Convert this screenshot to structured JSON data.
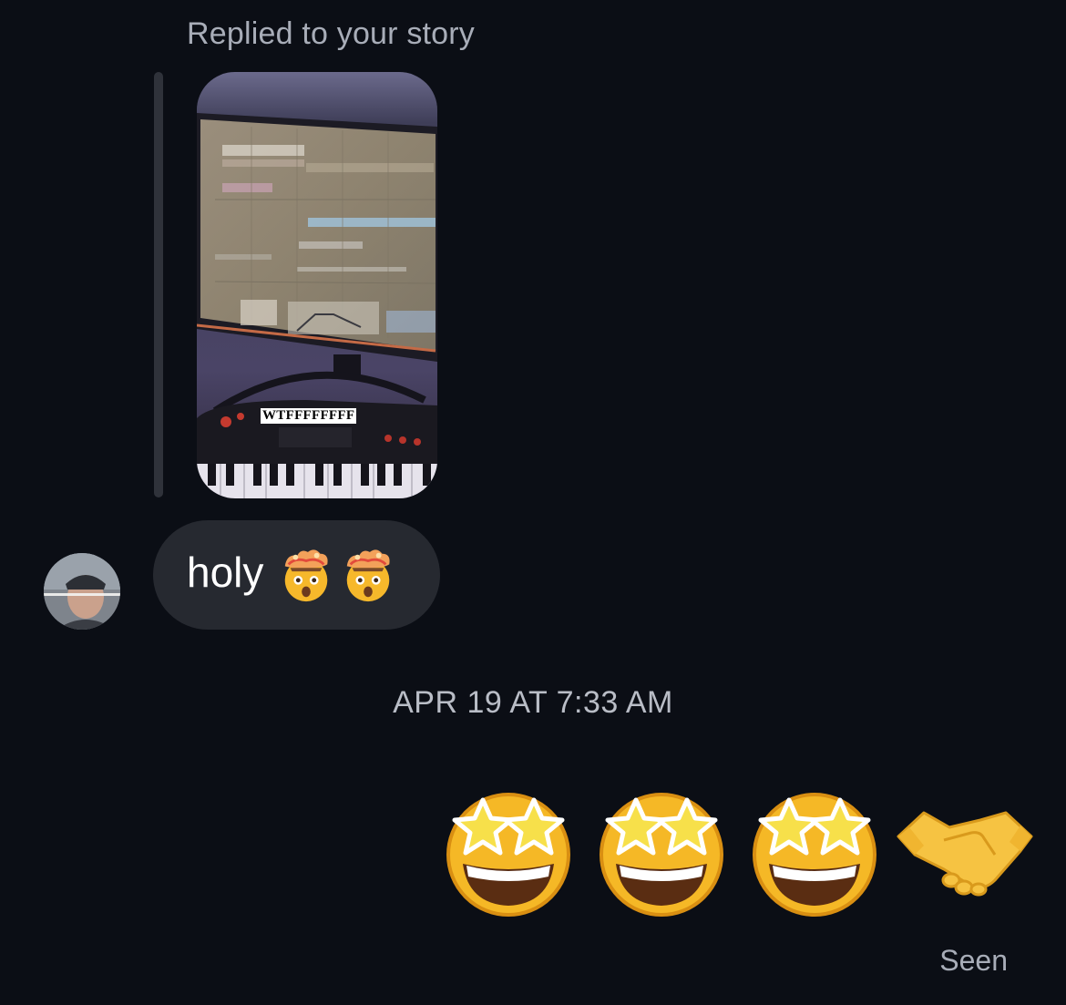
{
  "story_reply": {
    "label": "Replied to your story",
    "sticker_text": "WTFFFFFFFF"
  },
  "incoming_message": {
    "text": "holy",
    "emojis": [
      "exploding-head",
      "exploding-head"
    ]
  },
  "timestamp": "APR 19 AT 7:33 AM",
  "outgoing_message": {
    "emojis": [
      "star-struck",
      "star-struck",
      "star-struck",
      "handshake"
    ]
  },
  "status": {
    "seen_label": "Seen"
  }
}
